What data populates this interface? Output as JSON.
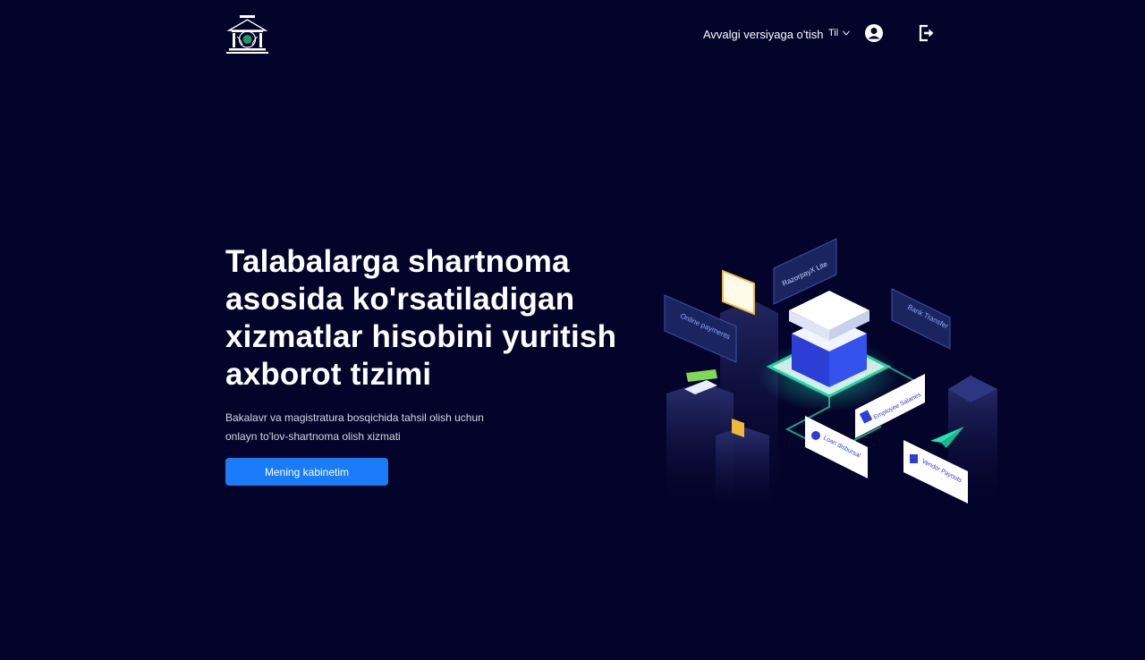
{
  "header": {
    "nav_link": "Avvalgi versiyaga o'tish",
    "language_label": "Til"
  },
  "hero": {
    "title": "Talabalarga shartnoma asosida ko'rsatiladigan xizmatlar hisobini yuritish axborot tizimi",
    "subtitle_line1": "Bakalavr va magistratura bosqichida tahsil olish uchun",
    "subtitle_line2": "onlayn to'lov-shartnoma olish xizmati",
    "cta_label": "Mening kabinetim"
  },
  "illustration": {
    "cards": {
      "online_payments": "Online payments",
      "razorpay": "RazorpayX Lite",
      "bank_transfer": "Bank Transfer",
      "employee_salaries": "Employee Salaries",
      "loan_disbursal": "Loan disbursal",
      "vendor_payouts": "Vendor Payouts"
    }
  },
  "colors": {
    "background": "#04032a",
    "accent": "#1a7cf9",
    "glow": "#22e3b0"
  }
}
